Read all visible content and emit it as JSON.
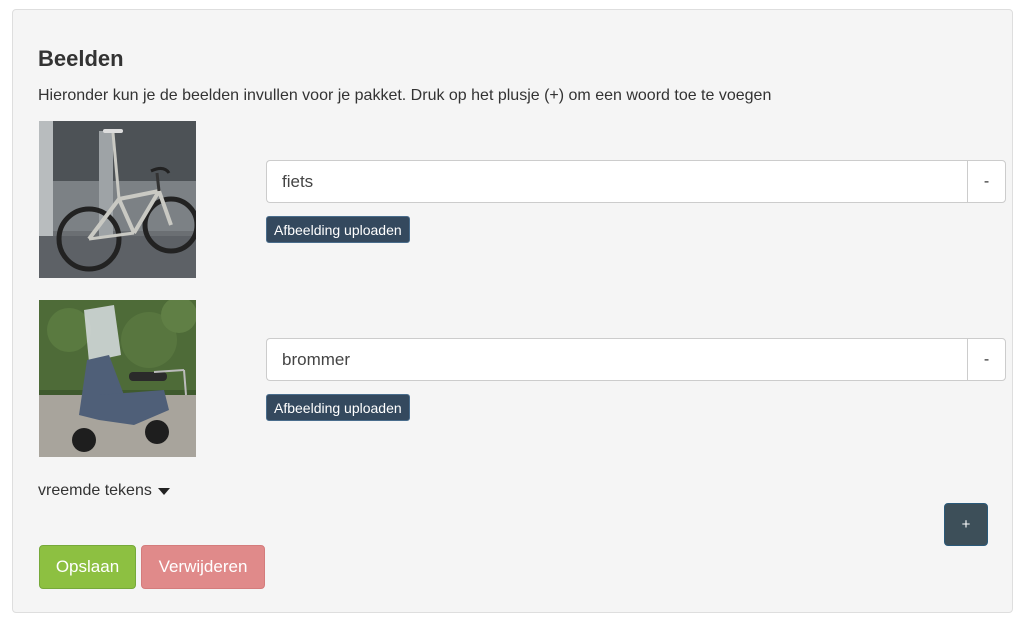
{
  "section": {
    "title": "Beelden",
    "instructions": "Hieronder kun je de beelden invullen voor je pakket. Druk op het plusje (+) om een woord toe te voegen"
  },
  "items": [
    {
      "image": "bicycle-photo",
      "word": "fiets",
      "remove_label": "-",
      "upload_label": "Afbeelding uploaden"
    },
    {
      "image": "scooter-photo",
      "word": "brommer",
      "remove_label": "-",
      "upload_label": "Afbeelding uploaden"
    }
  ],
  "special_chars": {
    "label": "vreemde tekens",
    "icon": "caret-down-icon"
  },
  "add_button": {
    "label": "+"
  },
  "actions": {
    "save_label": "Opslaan",
    "delete_label": "Verwijderen"
  },
  "colors": {
    "save": "#8dc041",
    "delete": "#e08a8a",
    "upload": "#34495e",
    "add": "#3d4f59"
  }
}
